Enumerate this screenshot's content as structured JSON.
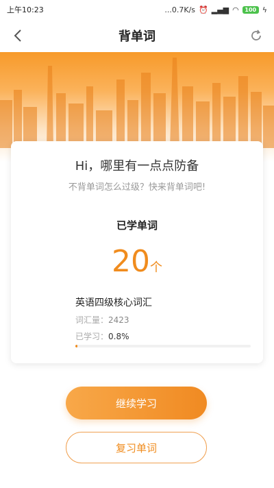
{
  "status_bar": {
    "time": "上午10:23",
    "net_speed": "...0.7K/s",
    "battery": "100"
  },
  "nav": {
    "title": "背单词"
  },
  "card": {
    "title": "Hi，哪里有一点点防备",
    "subtitle": "不背单词怎么过级？快来背单词吧!",
    "learned_label": "已学单词",
    "learned_count": "20",
    "learned_unit": "个",
    "book_name": "英语四级核心词汇",
    "vocab_label": "词汇量：",
    "vocab_value": "2423",
    "progress_label": "已学习：",
    "progress_value": "0.8%",
    "progress_fraction": 0.008
  },
  "buttons": {
    "continue_label": "继续学习",
    "review_label": "复习单词"
  },
  "colors": {
    "accent": "#f08c1e",
    "banner": "#f79a2a"
  }
}
